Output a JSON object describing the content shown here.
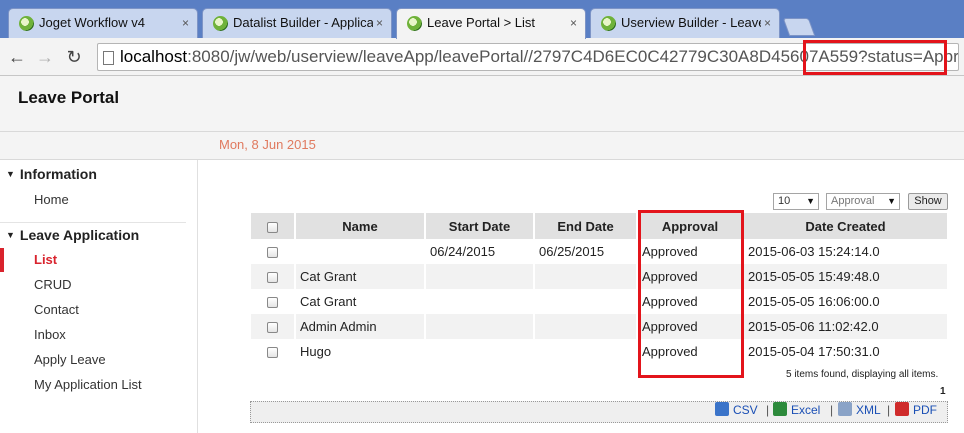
{
  "browser": {
    "tabs": [
      {
        "label": "Joget Workflow v4",
        "close": "×"
      },
      {
        "label": "Datalist Builder - Applicatio",
        "close": "×"
      },
      {
        "label": "Leave Portal  >  List",
        "close": "×"
      },
      {
        "label": "Userview Builder - Leave P",
        "close": "×"
      }
    ],
    "address": {
      "host": "localhost",
      "path": ":8080/jw/web/userview/leaveApp/leavePortal//2797C4D6EC0C42779C30A8D45607A559?status=Approved"
    }
  },
  "app": {
    "title": "Leave Portal",
    "date": "Mon, 8 Jun 2015"
  },
  "sidebar": {
    "sections": [
      {
        "label": "Information",
        "items": [
          "Home"
        ]
      },
      {
        "label": "Leave Application",
        "items": [
          "List",
          "CRUD",
          "Contact",
          "Inbox",
          "Apply Leave",
          "My Application List"
        ]
      }
    ],
    "current": "List"
  },
  "controls": {
    "page_size": "10",
    "filter": "Approval",
    "show_label": "Show"
  },
  "table": {
    "columns": [
      "Name",
      "Start Date",
      "End Date",
      "Approval",
      "Date Created"
    ],
    "rows": [
      {
        "name": "",
        "start": "06/24/2015",
        "end": "06/25/2015",
        "approval": "Approved",
        "created": "2015-06-03 15:24:14.0"
      },
      {
        "name": "Cat Grant",
        "start": "",
        "end": "",
        "approval": "Approved",
        "created": "2015-05-05 15:49:48.0"
      },
      {
        "name": "Cat Grant",
        "start": "",
        "end": "",
        "approval": "Approved",
        "created": "2015-05-05 16:06:00.0"
      },
      {
        "name": "Admin Admin",
        "start": "",
        "end": "",
        "approval": "Approved",
        "created": "2015-05-06 11:02:42.0"
      },
      {
        "name": "Hugo",
        "start": "",
        "end": "",
        "approval": "Approved",
        "created": "2015-05-04 17:50:31.0"
      }
    ]
  },
  "footer": {
    "found": "5 items found, displaying all items.",
    "page": "1",
    "exports": [
      "CSV",
      "Excel",
      "XML",
      "PDF"
    ]
  },
  "colors": {
    "highlight": "#e3141b",
    "current_nav": "#d9232d",
    "date": "#e07a5f"
  }
}
